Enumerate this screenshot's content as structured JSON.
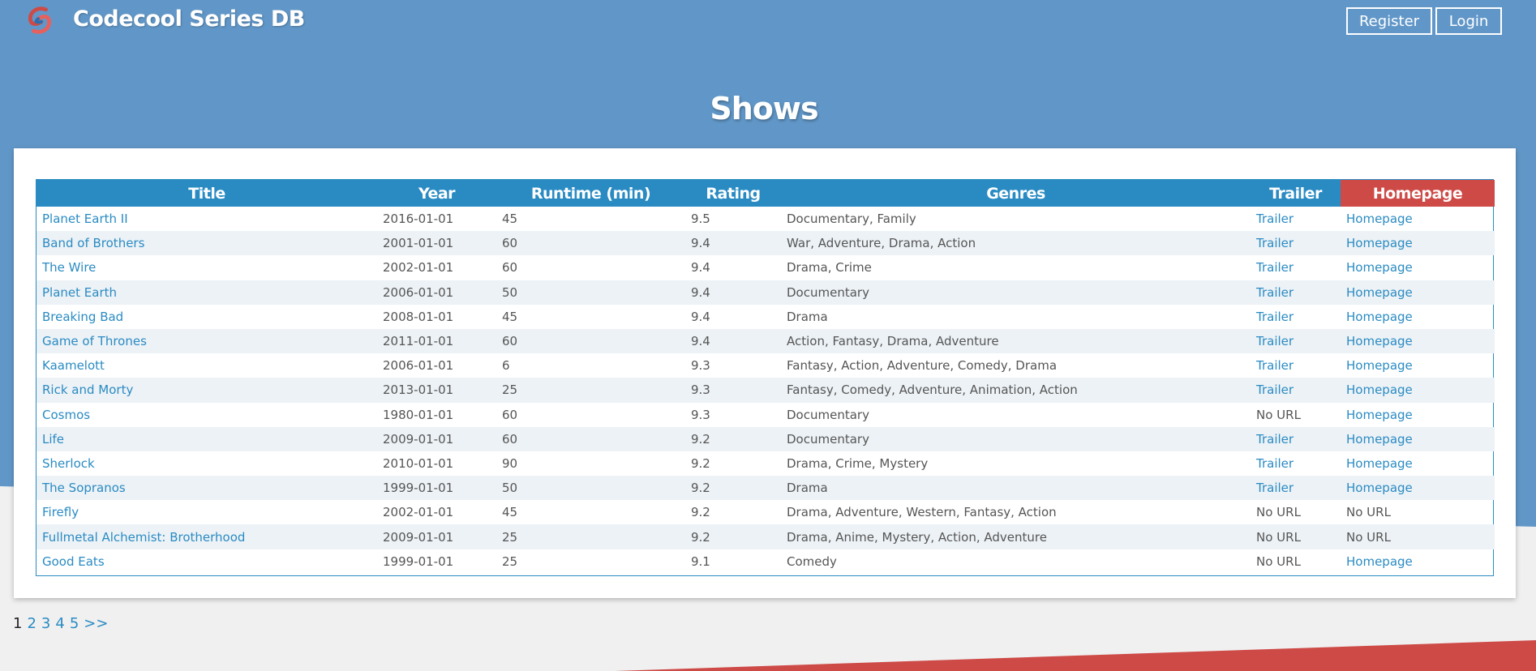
{
  "header": {
    "site_title": "Codecool Series DB",
    "register_label": "Register",
    "login_label": "Login",
    "logo_icon": "codecool-logo-icon"
  },
  "page": {
    "title": "Shows"
  },
  "colors": {
    "primary": "#2a8bc3",
    "accent": "#cd4a47",
    "header_bg": "#6197c8"
  },
  "table": {
    "columns": [
      "Title",
      "Year",
      "Runtime (min)",
      "Rating",
      "Genres",
      "Trailer",
      "Homepage"
    ],
    "rows": [
      {
        "title": "Planet Earth II",
        "year": "2016-01-01",
        "runtime": "45",
        "rating": "9.5",
        "genres": "Documentary, Family",
        "trailer": "Trailer",
        "homepage": "Homepage"
      },
      {
        "title": "Band of Brothers",
        "year": "2001-01-01",
        "runtime": "60",
        "rating": "9.4",
        "genres": "War, Adventure, Drama, Action",
        "trailer": "Trailer",
        "homepage": "Homepage"
      },
      {
        "title": "The Wire",
        "year": "2002-01-01",
        "runtime": "60",
        "rating": "9.4",
        "genres": "Drama, Crime",
        "trailer": "Trailer",
        "homepage": "Homepage"
      },
      {
        "title": "Planet Earth",
        "year": "2006-01-01",
        "runtime": "50",
        "rating": "9.4",
        "genres": "Documentary",
        "trailer": "Trailer",
        "homepage": "Homepage"
      },
      {
        "title": "Breaking Bad",
        "year": "2008-01-01",
        "runtime": "45",
        "rating": "9.4",
        "genres": "Drama",
        "trailer": "Trailer",
        "homepage": "Homepage"
      },
      {
        "title": "Game of Thrones",
        "year": "2011-01-01",
        "runtime": "60",
        "rating": "9.4",
        "genres": "Action, Fantasy, Drama, Adventure",
        "trailer": "Trailer",
        "homepage": "Homepage"
      },
      {
        "title": "Kaamelott",
        "year": "2006-01-01",
        "runtime": "6",
        "rating": "9.3",
        "genres": "Fantasy, Action, Adventure, Comedy, Drama",
        "trailer": "Trailer",
        "homepage": "Homepage"
      },
      {
        "title": "Rick and Morty",
        "year": "2013-01-01",
        "runtime": "25",
        "rating": "9.3",
        "genres": "Fantasy, Comedy, Adventure, Animation, Action",
        "trailer": "Trailer",
        "homepage": "Homepage"
      },
      {
        "title": "Cosmos",
        "year": "1980-01-01",
        "runtime": "60",
        "rating": "9.3",
        "genres": "Documentary",
        "trailer": "No URL",
        "homepage": "Homepage"
      },
      {
        "title": "Life",
        "year": "2009-01-01",
        "runtime": "60",
        "rating": "9.2",
        "genres": "Documentary",
        "trailer": "Trailer",
        "homepage": "Homepage"
      },
      {
        "title": "Sherlock",
        "year": "2010-01-01",
        "runtime": "90",
        "rating": "9.2",
        "genres": "Drama, Crime, Mystery",
        "trailer": "Trailer",
        "homepage": "Homepage"
      },
      {
        "title": "The Sopranos",
        "year": "1999-01-01",
        "runtime": "50",
        "rating": "9.2",
        "genres": "Drama",
        "trailer": "Trailer",
        "homepage": "Homepage"
      },
      {
        "title": "Firefly",
        "year": "2002-01-01",
        "runtime": "45",
        "rating": "9.2",
        "genres": "Drama, Adventure, Western, Fantasy, Action",
        "trailer": "No URL",
        "homepage": "No URL"
      },
      {
        "title": "Fullmetal Alchemist: Brotherhood",
        "year": "2009-01-01",
        "runtime": "25",
        "rating": "9.2",
        "genres": "Drama, Anime, Mystery, Action, Adventure",
        "trailer": "No URL",
        "homepage": "No URL"
      },
      {
        "title": "Good Eats",
        "year": "1999-01-01",
        "runtime": "25",
        "rating": "9.1",
        "genres": "Comedy",
        "trailer": "No URL",
        "homepage": "Homepage"
      }
    ]
  },
  "pagination": {
    "current": "1",
    "pages": [
      "2",
      "3",
      "4",
      "5"
    ],
    "next_label": ">>"
  }
}
